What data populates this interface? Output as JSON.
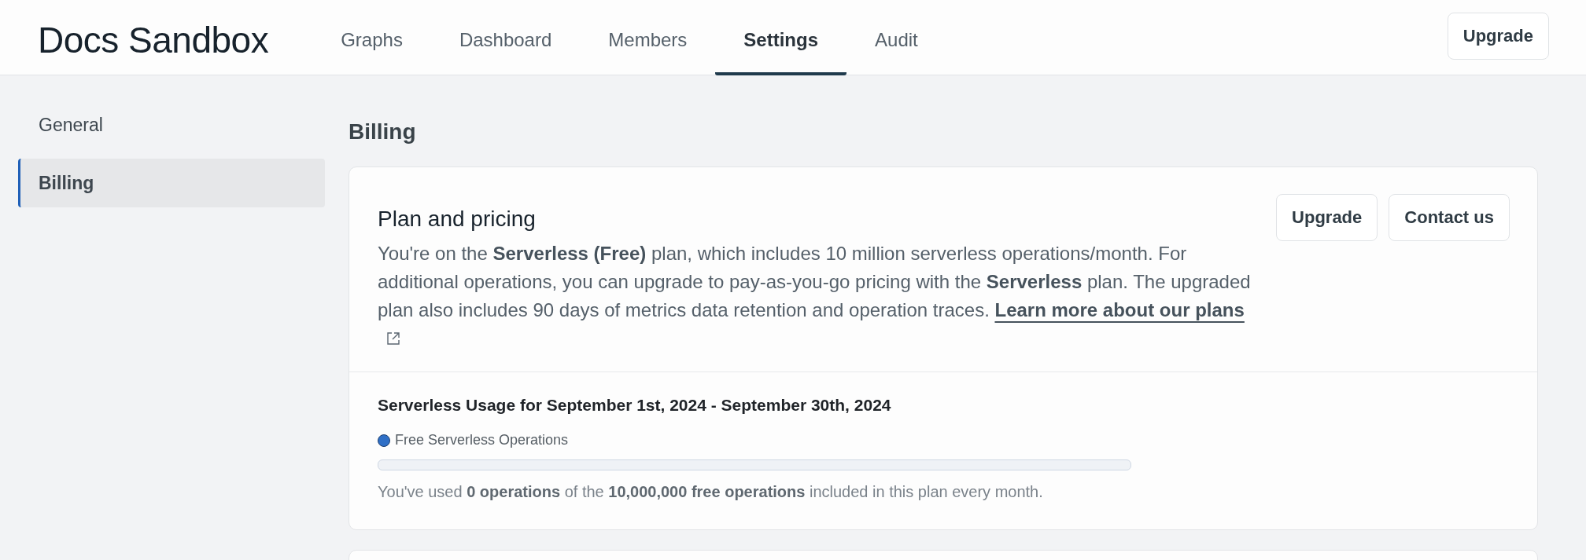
{
  "header": {
    "logo": "Docs Sandbox",
    "tabs": [
      {
        "label": "Graphs",
        "selected": false
      },
      {
        "label": "Dashboard",
        "selected": false
      },
      {
        "label": "Members",
        "selected": false
      },
      {
        "label": "Settings",
        "selected": true
      },
      {
        "label": "Audit",
        "selected": false
      }
    ],
    "upgrade_button": "Upgrade"
  },
  "sidebar": {
    "items": [
      {
        "label": "General",
        "selected": false
      },
      {
        "label": "Billing",
        "selected": true
      }
    ]
  },
  "page_title": "Billing",
  "plan_card": {
    "title": "Plan and pricing",
    "description": "You're on the **Serverless (Free)** plan, which includes 10 million serverless operations/month. For additional operations, you can upgrade to pay-as-you-go pricing with the **Serverless** plan. The upgraded plan also includes 90 days of metrics data retention and operation traces.",
    "link": "Learn more about our plans",
    "buttons": [
      "Upgrade",
      "Contact us"
    ],
    "usage": {
      "title": "Serverless Usage for September 1st, 2024 - September 30th, 2024",
      "legend": {
        "label": "Free Serverless Operations",
        "color": "#2f6fc6"
      },
      "level": 0,
      "note": "You've used **0 operations** of the **10,000,000 free operations** included in this plan every month."
    }
  }
}
